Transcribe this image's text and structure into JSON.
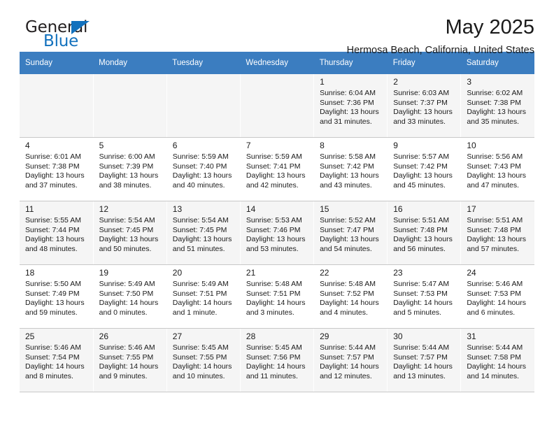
{
  "brand": {
    "name_top": "General",
    "name_bottom": "Blue",
    "triangle_color": "#1271bd",
    "text_color": "#231f20"
  },
  "header": {
    "month_title": "May 2025",
    "location": "Hermosa Beach, California, United States"
  },
  "theme": {
    "header_row_bg": "#3b7dc0",
    "header_row_text": "#ffffff",
    "shaded_row_bg": "#f5f5f5",
    "plain_row_bg": "#ffffff",
    "cell_border": "#c8c8c8"
  },
  "weekday_headers": [
    "Sunday",
    "Monday",
    "Tuesday",
    "Wednesday",
    "Thursday",
    "Friday",
    "Saturday"
  ],
  "weeks": [
    {
      "shaded": true,
      "days": [
        {
          "empty": true,
          "num": "",
          "sunrise": "",
          "sunset": "",
          "daylight_1": "",
          "daylight_2": ""
        },
        {
          "empty": true,
          "num": "",
          "sunrise": "",
          "sunset": "",
          "daylight_1": "",
          "daylight_2": ""
        },
        {
          "empty": true,
          "num": "",
          "sunrise": "",
          "sunset": "",
          "daylight_1": "",
          "daylight_2": ""
        },
        {
          "empty": true,
          "num": "",
          "sunrise": "",
          "sunset": "",
          "daylight_1": "",
          "daylight_2": ""
        },
        {
          "empty": false,
          "num": "1",
          "sunrise": "Sunrise: 6:04 AM",
          "sunset": "Sunset: 7:36 PM",
          "daylight_1": "Daylight: 13 hours",
          "daylight_2": "and 31 minutes."
        },
        {
          "empty": false,
          "num": "2",
          "sunrise": "Sunrise: 6:03 AM",
          "sunset": "Sunset: 7:37 PM",
          "daylight_1": "Daylight: 13 hours",
          "daylight_2": "and 33 minutes."
        },
        {
          "empty": false,
          "num": "3",
          "sunrise": "Sunrise: 6:02 AM",
          "sunset": "Sunset: 7:38 PM",
          "daylight_1": "Daylight: 13 hours",
          "daylight_2": "and 35 minutes."
        }
      ]
    },
    {
      "shaded": false,
      "days": [
        {
          "empty": false,
          "num": "4",
          "sunrise": "Sunrise: 6:01 AM",
          "sunset": "Sunset: 7:38 PM",
          "daylight_1": "Daylight: 13 hours",
          "daylight_2": "and 37 minutes."
        },
        {
          "empty": false,
          "num": "5",
          "sunrise": "Sunrise: 6:00 AM",
          "sunset": "Sunset: 7:39 PM",
          "daylight_1": "Daylight: 13 hours",
          "daylight_2": "and 38 minutes."
        },
        {
          "empty": false,
          "num": "6",
          "sunrise": "Sunrise: 5:59 AM",
          "sunset": "Sunset: 7:40 PM",
          "daylight_1": "Daylight: 13 hours",
          "daylight_2": "and 40 minutes."
        },
        {
          "empty": false,
          "num": "7",
          "sunrise": "Sunrise: 5:59 AM",
          "sunset": "Sunset: 7:41 PM",
          "daylight_1": "Daylight: 13 hours",
          "daylight_2": "and 42 minutes."
        },
        {
          "empty": false,
          "num": "8",
          "sunrise": "Sunrise: 5:58 AM",
          "sunset": "Sunset: 7:42 PM",
          "daylight_1": "Daylight: 13 hours",
          "daylight_2": "and 43 minutes."
        },
        {
          "empty": false,
          "num": "9",
          "sunrise": "Sunrise: 5:57 AM",
          "sunset": "Sunset: 7:42 PM",
          "daylight_1": "Daylight: 13 hours",
          "daylight_2": "and 45 minutes."
        },
        {
          "empty": false,
          "num": "10",
          "sunrise": "Sunrise: 5:56 AM",
          "sunset": "Sunset: 7:43 PM",
          "daylight_1": "Daylight: 13 hours",
          "daylight_2": "and 47 minutes."
        }
      ]
    },
    {
      "shaded": true,
      "days": [
        {
          "empty": false,
          "num": "11",
          "sunrise": "Sunrise: 5:55 AM",
          "sunset": "Sunset: 7:44 PM",
          "daylight_1": "Daylight: 13 hours",
          "daylight_2": "and 48 minutes."
        },
        {
          "empty": false,
          "num": "12",
          "sunrise": "Sunrise: 5:54 AM",
          "sunset": "Sunset: 7:45 PM",
          "daylight_1": "Daylight: 13 hours",
          "daylight_2": "and 50 minutes."
        },
        {
          "empty": false,
          "num": "13",
          "sunrise": "Sunrise: 5:54 AM",
          "sunset": "Sunset: 7:45 PM",
          "daylight_1": "Daylight: 13 hours",
          "daylight_2": "and 51 minutes."
        },
        {
          "empty": false,
          "num": "14",
          "sunrise": "Sunrise: 5:53 AM",
          "sunset": "Sunset: 7:46 PM",
          "daylight_1": "Daylight: 13 hours",
          "daylight_2": "and 53 minutes."
        },
        {
          "empty": false,
          "num": "15",
          "sunrise": "Sunrise: 5:52 AM",
          "sunset": "Sunset: 7:47 PM",
          "daylight_1": "Daylight: 13 hours",
          "daylight_2": "and 54 minutes."
        },
        {
          "empty": false,
          "num": "16",
          "sunrise": "Sunrise: 5:51 AM",
          "sunset": "Sunset: 7:48 PM",
          "daylight_1": "Daylight: 13 hours",
          "daylight_2": "and 56 minutes."
        },
        {
          "empty": false,
          "num": "17",
          "sunrise": "Sunrise: 5:51 AM",
          "sunset": "Sunset: 7:48 PM",
          "daylight_1": "Daylight: 13 hours",
          "daylight_2": "and 57 minutes."
        }
      ]
    },
    {
      "shaded": false,
      "days": [
        {
          "empty": false,
          "num": "18",
          "sunrise": "Sunrise: 5:50 AM",
          "sunset": "Sunset: 7:49 PM",
          "daylight_1": "Daylight: 13 hours",
          "daylight_2": "and 59 minutes."
        },
        {
          "empty": false,
          "num": "19",
          "sunrise": "Sunrise: 5:49 AM",
          "sunset": "Sunset: 7:50 PM",
          "daylight_1": "Daylight: 14 hours",
          "daylight_2": "and 0 minutes."
        },
        {
          "empty": false,
          "num": "20",
          "sunrise": "Sunrise: 5:49 AM",
          "sunset": "Sunset: 7:51 PM",
          "daylight_1": "Daylight: 14 hours",
          "daylight_2": "and 1 minute."
        },
        {
          "empty": false,
          "num": "21",
          "sunrise": "Sunrise: 5:48 AM",
          "sunset": "Sunset: 7:51 PM",
          "daylight_1": "Daylight: 14 hours",
          "daylight_2": "and 3 minutes."
        },
        {
          "empty": false,
          "num": "22",
          "sunrise": "Sunrise: 5:48 AM",
          "sunset": "Sunset: 7:52 PM",
          "daylight_1": "Daylight: 14 hours",
          "daylight_2": "and 4 minutes."
        },
        {
          "empty": false,
          "num": "23",
          "sunrise": "Sunrise: 5:47 AM",
          "sunset": "Sunset: 7:53 PM",
          "daylight_1": "Daylight: 14 hours",
          "daylight_2": "and 5 minutes."
        },
        {
          "empty": false,
          "num": "24",
          "sunrise": "Sunrise: 5:46 AM",
          "sunset": "Sunset: 7:53 PM",
          "daylight_1": "Daylight: 14 hours",
          "daylight_2": "and 6 minutes."
        }
      ]
    },
    {
      "shaded": true,
      "days": [
        {
          "empty": false,
          "num": "25",
          "sunrise": "Sunrise: 5:46 AM",
          "sunset": "Sunset: 7:54 PM",
          "daylight_1": "Daylight: 14 hours",
          "daylight_2": "and 8 minutes."
        },
        {
          "empty": false,
          "num": "26",
          "sunrise": "Sunrise: 5:46 AM",
          "sunset": "Sunset: 7:55 PM",
          "daylight_1": "Daylight: 14 hours",
          "daylight_2": "and 9 minutes."
        },
        {
          "empty": false,
          "num": "27",
          "sunrise": "Sunrise: 5:45 AM",
          "sunset": "Sunset: 7:55 PM",
          "daylight_1": "Daylight: 14 hours",
          "daylight_2": "and 10 minutes."
        },
        {
          "empty": false,
          "num": "28",
          "sunrise": "Sunrise: 5:45 AM",
          "sunset": "Sunset: 7:56 PM",
          "daylight_1": "Daylight: 14 hours",
          "daylight_2": "and 11 minutes."
        },
        {
          "empty": false,
          "num": "29",
          "sunrise": "Sunrise: 5:44 AM",
          "sunset": "Sunset: 7:57 PM",
          "daylight_1": "Daylight: 14 hours",
          "daylight_2": "and 12 minutes."
        },
        {
          "empty": false,
          "num": "30",
          "sunrise": "Sunrise: 5:44 AM",
          "sunset": "Sunset: 7:57 PM",
          "daylight_1": "Daylight: 14 hours",
          "daylight_2": "and 13 minutes."
        },
        {
          "empty": false,
          "num": "31",
          "sunrise": "Sunrise: 5:44 AM",
          "sunset": "Sunset: 7:58 PM",
          "daylight_1": "Daylight: 14 hours",
          "daylight_2": "and 14 minutes."
        }
      ]
    }
  ]
}
